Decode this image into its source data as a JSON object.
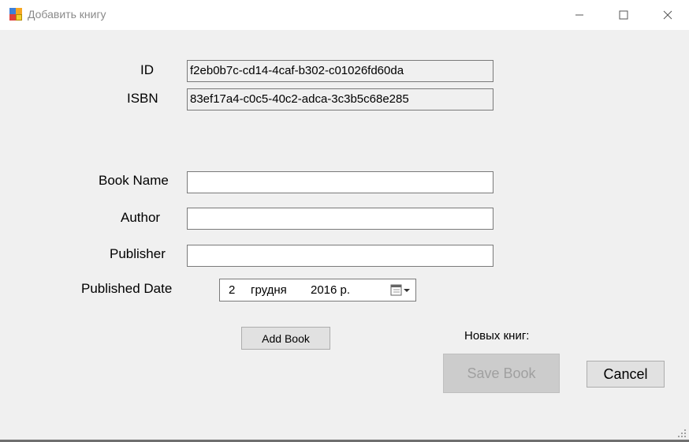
{
  "window": {
    "title": "Добавить книгу",
    "icon": "app-window-icon",
    "controls": [
      "minimize-icon",
      "maximize-icon",
      "close-icon"
    ]
  },
  "form": {
    "id_label": "ID",
    "id_value": "f2eb0b7c-cd14-4caf-b302-c01026fd60da",
    "isbn_label": "ISBN",
    "isbn_value": "83ef17a4-c0c5-40c2-adca-3c3b5c68e285",
    "book_name_label": "Book Name",
    "book_name_value": "",
    "author_label": "Author",
    "author_value": "",
    "publisher_label": "Publisher",
    "publisher_value": "",
    "published_date_label": "Published Date",
    "date": {
      "day": "2",
      "month": "грудня",
      "year": "2016 р.",
      "icon": "calendar-dropdown-icon"
    }
  },
  "buttons": {
    "add_book": "Add Book",
    "save_book": "Save Book",
    "cancel": "Cancel"
  },
  "status": {
    "new_books_label": "Новых книг:"
  },
  "colors": {
    "window_bg": "#f0f0f0",
    "titlebar_bg": "#ffffff",
    "disabled_button_bg": "#cccccc",
    "disabled_button_text": "#a0a0a0"
  }
}
